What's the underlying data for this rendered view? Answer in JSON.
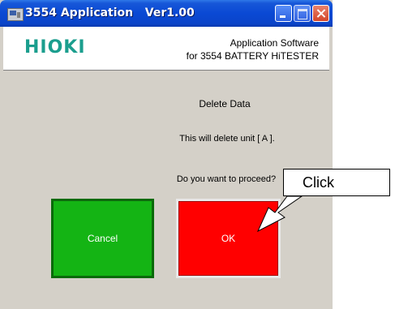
{
  "window": {
    "title": "3554 Application   Ver1.00"
  },
  "header": {
    "logo": "HIOKI",
    "app_line1": "Application Software",
    "app_line2": "for 3554 BATTERY HiTESTER"
  },
  "dialog": {
    "heading": "Delete Data",
    "message": "This will delete unit [ A ].",
    "question": "Do you want to proceed?"
  },
  "buttons": {
    "cancel": "Cancel",
    "ok": "OK"
  },
  "annotation": {
    "label": "Click"
  },
  "colors": {
    "cancel": "#14b414",
    "ok": "#ff0000",
    "logo": "#1b9e8e"
  }
}
